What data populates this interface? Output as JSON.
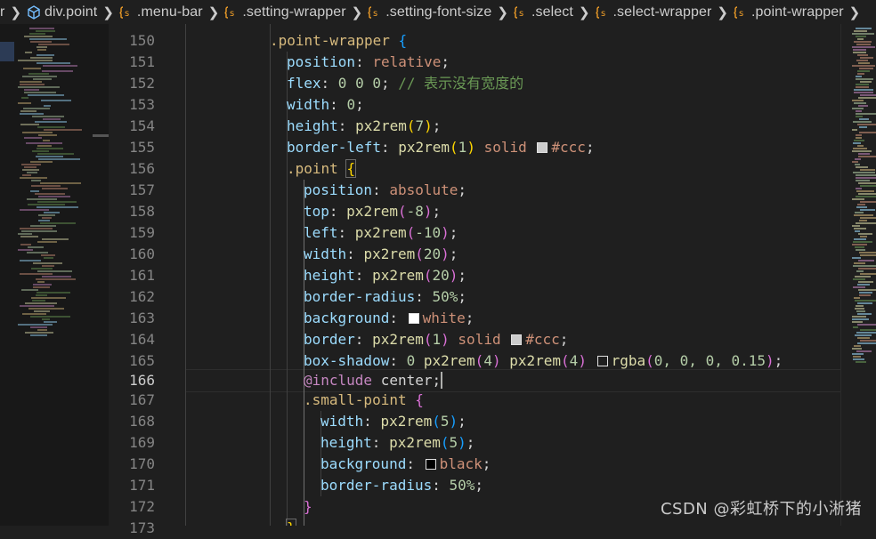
{
  "breadcrumb": {
    "items": [
      {
        "label": "r",
        "icon": "none"
      },
      {
        "label": "div.point",
        "icon": "cube-icon"
      },
      {
        "label": ".menu-bar",
        "icon": "scss-selector-icon"
      },
      {
        "label": ".setting-wrapper",
        "icon": "scss-selector-icon"
      },
      {
        "label": ".setting-font-size",
        "icon": "scss-selector-icon"
      },
      {
        "label": ".select",
        "icon": "scss-selector-icon"
      },
      {
        "label": ".select-wrapper",
        "icon": "scss-selector-icon"
      },
      {
        "label": ".point-wrapper",
        "icon": "scss-selector-icon"
      }
    ]
  },
  "editor": {
    "active_line": 166,
    "lines": [
      {
        "no": "150"
      },
      {
        "no": "151"
      },
      {
        "no": "152"
      },
      {
        "no": "153"
      },
      {
        "no": "154"
      },
      {
        "no": "155"
      },
      {
        "no": "156"
      },
      {
        "no": "157"
      },
      {
        "no": "158"
      },
      {
        "no": "159"
      },
      {
        "no": "160"
      },
      {
        "no": "161"
      },
      {
        "no": "162"
      },
      {
        "no": "163"
      },
      {
        "no": "164"
      },
      {
        "no": "165"
      },
      {
        "no": "166"
      },
      {
        "no": "167"
      },
      {
        "no": "168"
      },
      {
        "no": "169"
      },
      {
        "no": "170"
      },
      {
        "no": "171"
      },
      {
        "no": "172"
      },
      {
        "no": "173"
      }
    ],
    "code": {
      "l150": {
        "sel": ".point-wrapper",
        "brace": "{"
      },
      "l151": {
        "prop": "position",
        "val": "relative"
      },
      "l152": {
        "prop": "flex",
        "val": "0 0 0",
        "comment": "// 表示没有宽度的"
      },
      "l153": {
        "prop": "width",
        "val": "0"
      },
      "l154": {
        "prop": "height",
        "fn": "px2rem",
        "arg": "7"
      },
      "l155": {
        "prop": "border-left",
        "fn": "px2rem",
        "arg": "1",
        "style": "solid",
        "color": "#ccc"
      },
      "l156": {
        "sel": ".point",
        "brace": "{"
      },
      "l157": {
        "prop": "position",
        "val": "absolute"
      },
      "l158": {
        "prop": "top",
        "fn": "px2rem",
        "arg": "-8"
      },
      "l159": {
        "prop": "left",
        "fn": "px2rem",
        "arg": "-10"
      },
      "l160": {
        "prop": "width",
        "fn": "px2rem",
        "arg": "20"
      },
      "l161": {
        "prop": "height",
        "fn": "px2rem",
        "arg": "20"
      },
      "l162": {
        "prop": "border-radius",
        "val": "50%"
      },
      "l163": {
        "prop": "background",
        "val": "white"
      },
      "l164": {
        "prop": "border",
        "fn": "px2rem",
        "arg": "1",
        "style": "solid",
        "color": "#ccc"
      },
      "l165": {
        "prop": "box-shadow",
        "n0": "0",
        "fn": "px2rem",
        "arg1": "4",
        "arg2": "4",
        "rgba": "rgba",
        "rgba_args": "0, 0, 0, 0.15"
      },
      "l166": {
        "at": "@include",
        "mixin": "center"
      },
      "l167": {
        "sel": ".small-point",
        "brace": "{"
      },
      "l168": {
        "prop": "width",
        "fn": "px2rem",
        "arg": "5"
      },
      "l169": {
        "prop": "height",
        "fn": "px2rem",
        "arg": "5"
      },
      "l170": {
        "prop": "background",
        "val": "black"
      },
      "l171": {
        "prop": "border-radius",
        "val": "50%"
      },
      "l172": {
        "brace": "}"
      },
      "l173": {
        "brace": "}"
      }
    },
    "swatch_colors": {
      "ccc": "#cccccc",
      "white": "#ffffff",
      "black": "#000000",
      "shadow": "#1f1f1f"
    }
  },
  "watermark": "CSDN @彩虹桥下的小淅猪",
  "theme": {
    "background": "#1f1f1f",
    "property": "#9cdcfe",
    "value": "#ce9178",
    "number": "#b5cea8",
    "function": "#dcdcaa",
    "selector": "#d7ba7d",
    "comment": "#6a9955"
  }
}
